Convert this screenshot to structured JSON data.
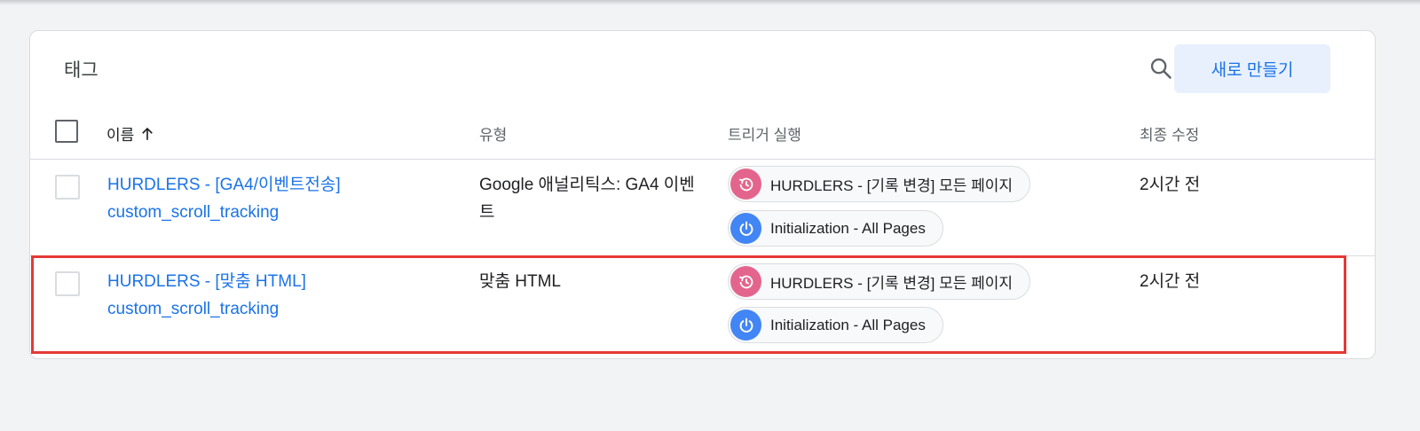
{
  "title": "태그",
  "new_button_label": "새로 만들기",
  "columns": {
    "name": "이름",
    "type": "유형",
    "triggers": "트리거 실행",
    "modified": "최종 수정"
  },
  "rows": [
    {
      "name_line1": "HURDLERS - [GA4/이벤트전송]",
      "name_line2": "custom_scroll_tracking",
      "type_line1": "Google 애널리틱스: GA4 이벤",
      "type_line2": "트",
      "triggers": [
        {
          "label": "HURDLERS - [기록 변경] 모든 페이지",
          "icon": "history-icon",
          "color": "#e3658e"
        },
        {
          "label": "Initialization - All Pages",
          "icon": "power-icon",
          "color": "#4285f4"
        }
      ],
      "modified": "2시간 전"
    },
    {
      "name_line1": "HURDLERS - [맞춤 HTML]",
      "name_line2": "custom_scroll_tracking",
      "type_line1": "맞춤 HTML",
      "type_line2": "",
      "triggers": [
        {
          "label": "HURDLERS - [기록 변경] 모든 페이지",
          "icon": "history-icon",
          "color": "#e3658e"
        },
        {
          "label": "Initialization - All Pages",
          "icon": "power-icon",
          "color": "#4285f4"
        }
      ],
      "modified": "2시간 전"
    }
  ],
  "colors": {
    "accent": "#1a73e8",
    "highlight_border": "#e53935"
  }
}
